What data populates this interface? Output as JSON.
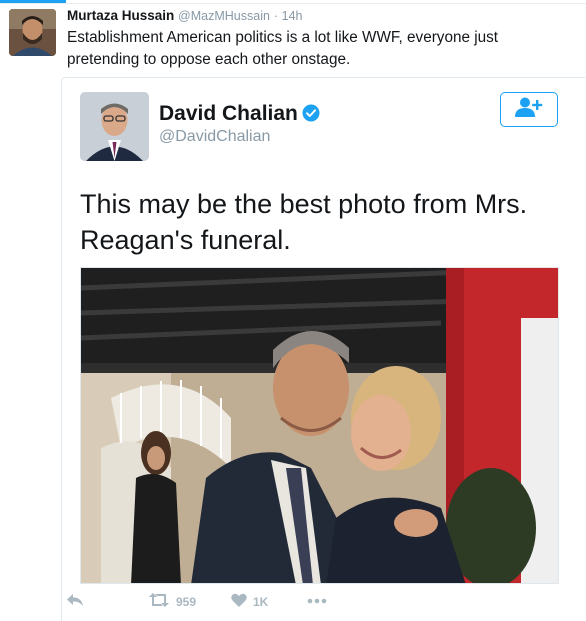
{
  "tweet": {
    "author_name": "Murtaza Hussain",
    "author_handle": "@MazMHussain",
    "separator": "·",
    "time": "14h",
    "text": "Establishment American politics is a lot like WWF, everyone just pretending to oppose each other onstage."
  },
  "quoted": {
    "author_name": "David Chalian",
    "author_handle": "@DavidChalian",
    "verified": true,
    "text": "This may be the best photo from Mrs. Reagan's funeral.",
    "follow_icon": "add-user-icon"
  },
  "actions": {
    "reply_icon": "reply-icon",
    "retweet_icon": "retweet-icon",
    "retweet_count": "959",
    "like_icon": "heart-icon",
    "like_count": "1K",
    "more_icon": "more-dots-icon"
  },
  "colors": {
    "accent": "#1da1f2",
    "action_gray": "#aab8c2",
    "meta_gray": "#8899a6",
    "text": "#14171a"
  }
}
